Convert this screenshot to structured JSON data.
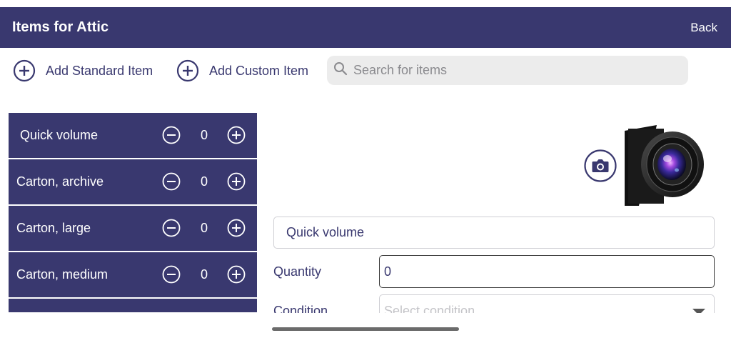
{
  "header": {
    "title": "Items for Attic",
    "back_label": "Back"
  },
  "toolbar": {
    "add_standard_label": "Add Standard Item",
    "add_custom_label": "Add Custom Item",
    "search_placeholder": "Search for items"
  },
  "items": [
    {
      "name": "Quick volume",
      "count": "0"
    },
    {
      "name": "Carton, archive",
      "count": "0"
    },
    {
      "name": "Carton, large",
      "count": "0"
    },
    {
      "name": "Carton, medium",
      "count": "0"
    }
  ],
  "detail": {
    "name_value": "Quick volume",
    "quantity_label": "Quantity",
    "quantity_value": "0",
    "condition_label": "Condition",
    "condition_placeholder": "Select condition"
  },
  "colors": {
    "accent": "#39386f",
    "search_bg": "#ececec"
  },
  "icons": {
    "add": "plus-circle-icon",
    "search": "search-icon",
    "minus": "minus-circle-icon",
    "camera": "camera-icon"
  }
}
